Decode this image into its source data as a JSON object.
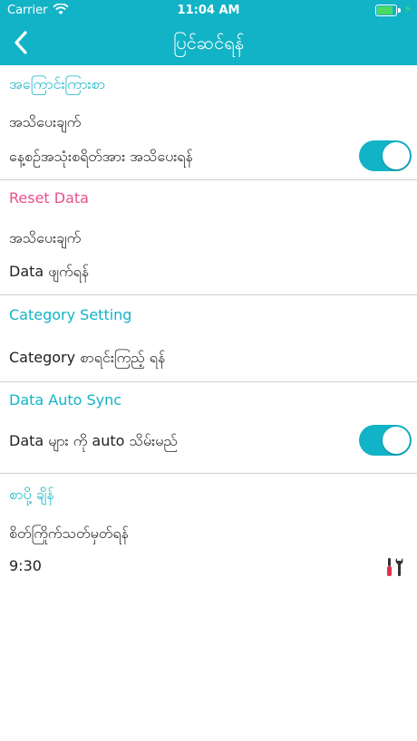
{
  "status_bar": {
    "carrier": "Carrier",
    "time": "11:04 AM",
    "battery_icon": "battery-charging-icon",
    "wifi_icon": "wifi-icon"
  },
  "nav": {
    "title": "ပြင်ဆင်ရန်",
    "back_icon": "chevron-left-icon"
  },
  "colors": {
    "accent": "#12b3c6",
    "reset_header": "#e8508d",
    "divider": "#cfcfcf",
    "text": "#222222"
  },
  "sections": {
    "notifications": {
      "header": "အကြောင်းကြားစာ",
      "row1": "အသိပေးချက်",
      "row2": "နေ့စဉ်အသုံးစရိတ်အား အသိပေးရန်",
      "toggle_on": true
    },
    "reset": {
      "header": "Reset Data",
      "row1": "အသိပေးချက်",
      "row2": "Data ဖျက်ရန်"
    },
    "category": {
      "header": "Category Setting",
      "row1": "Category စာရင်းကြည့် ရန်"
    },
    "sync": {
      "header": "Data Auto Sync",
      "row1": "Data များ ကို auto သိမ်းမည်",
      "toggle_on": true
    },
    "reminder": {
      "header": "စာပို့ ချိန်",
      "row1": "စိတ်ကြိုက်သတ်မှတ်ရန်",
      "time": "9:30",
      "tools_icon": "tools-icon"
    }
  }
}
